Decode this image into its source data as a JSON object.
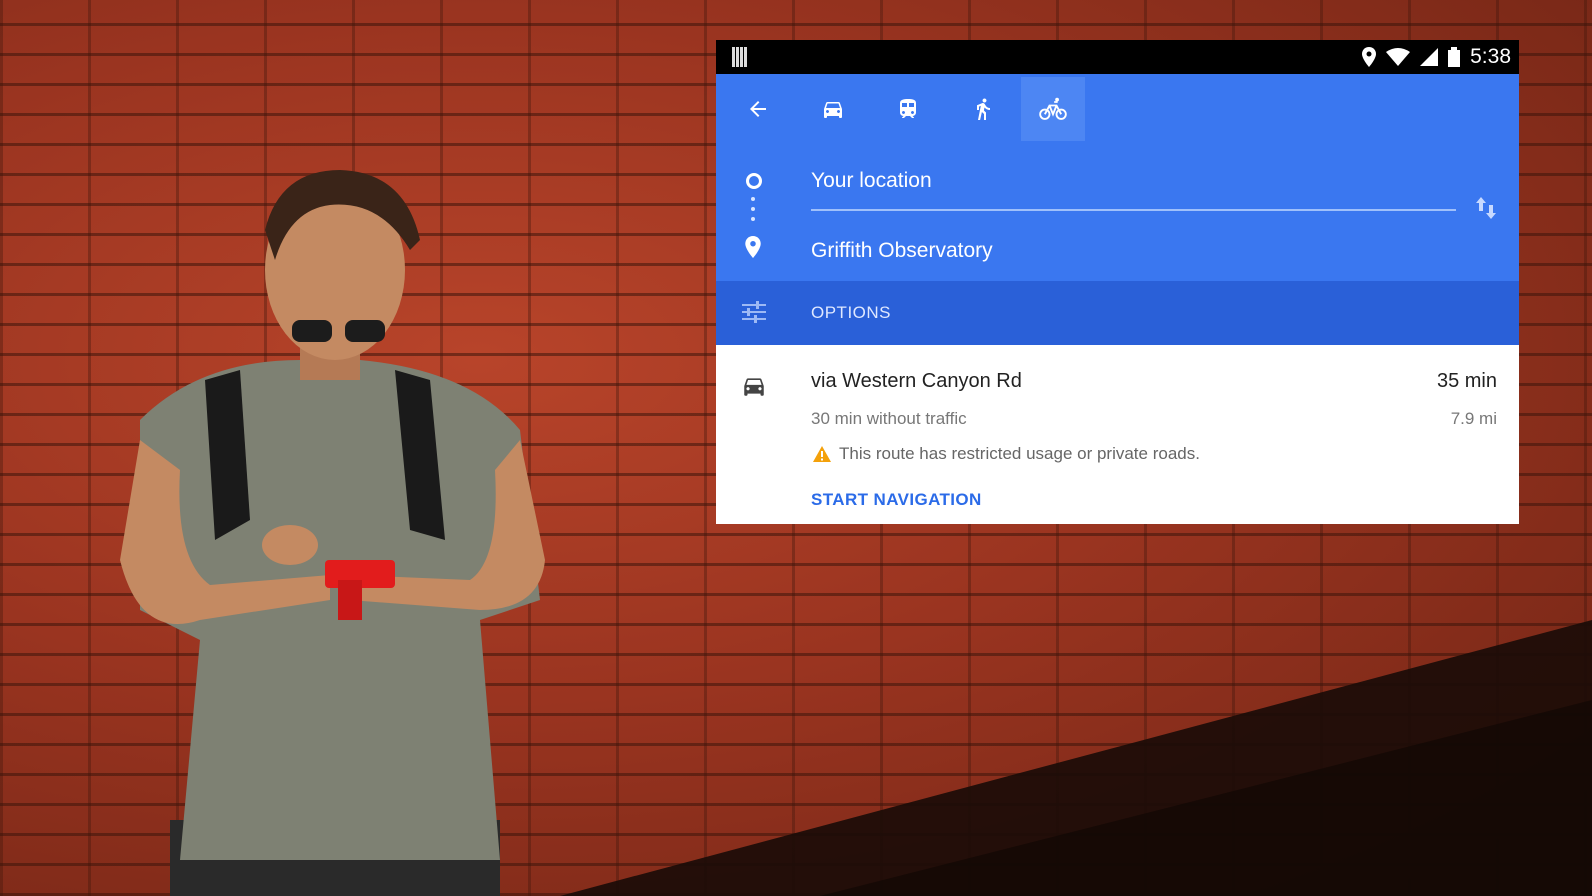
{
  "statusbar": {
    "time": "5:38"
  },
  "travel_modes": [
    {
      "mode": "back",
      "icon": "arrow-left-icon"
    },
    {
      "mode": "driving",
      "icon": "car-icon"
    },
    {
      "mode": "transit",
      "icon": "train-icon"
    },
    {
      "mode": "walking",
      "icon": "walking-icon"
    },
    {
      "mode": "cycling",
      "icon": "bicycle-icon",
      "selected": true
    }
  ],
  "route": {
    "origin": "Your location",
    "destination": "Griffith Observatory"
  },
  "options": {
    "label": "OPTIONS"
  },
  "result": {
    "via": "via Western Canyon Rd",
    "duration": "35 min",
    "without_traffic": "30 min without traffic",
    "distance": "7.9 mi",
    "warning": "This route has restricted usage or private roads.",
    "start_navigation": "START NAVIGATION"
  },
  "colors": {
    "header_blue": "#3a77f0",
    "options_blue": "#2a60d8",
    "accent": "#2b6be8",
    "warning": "#f4a10a"
  }
}
